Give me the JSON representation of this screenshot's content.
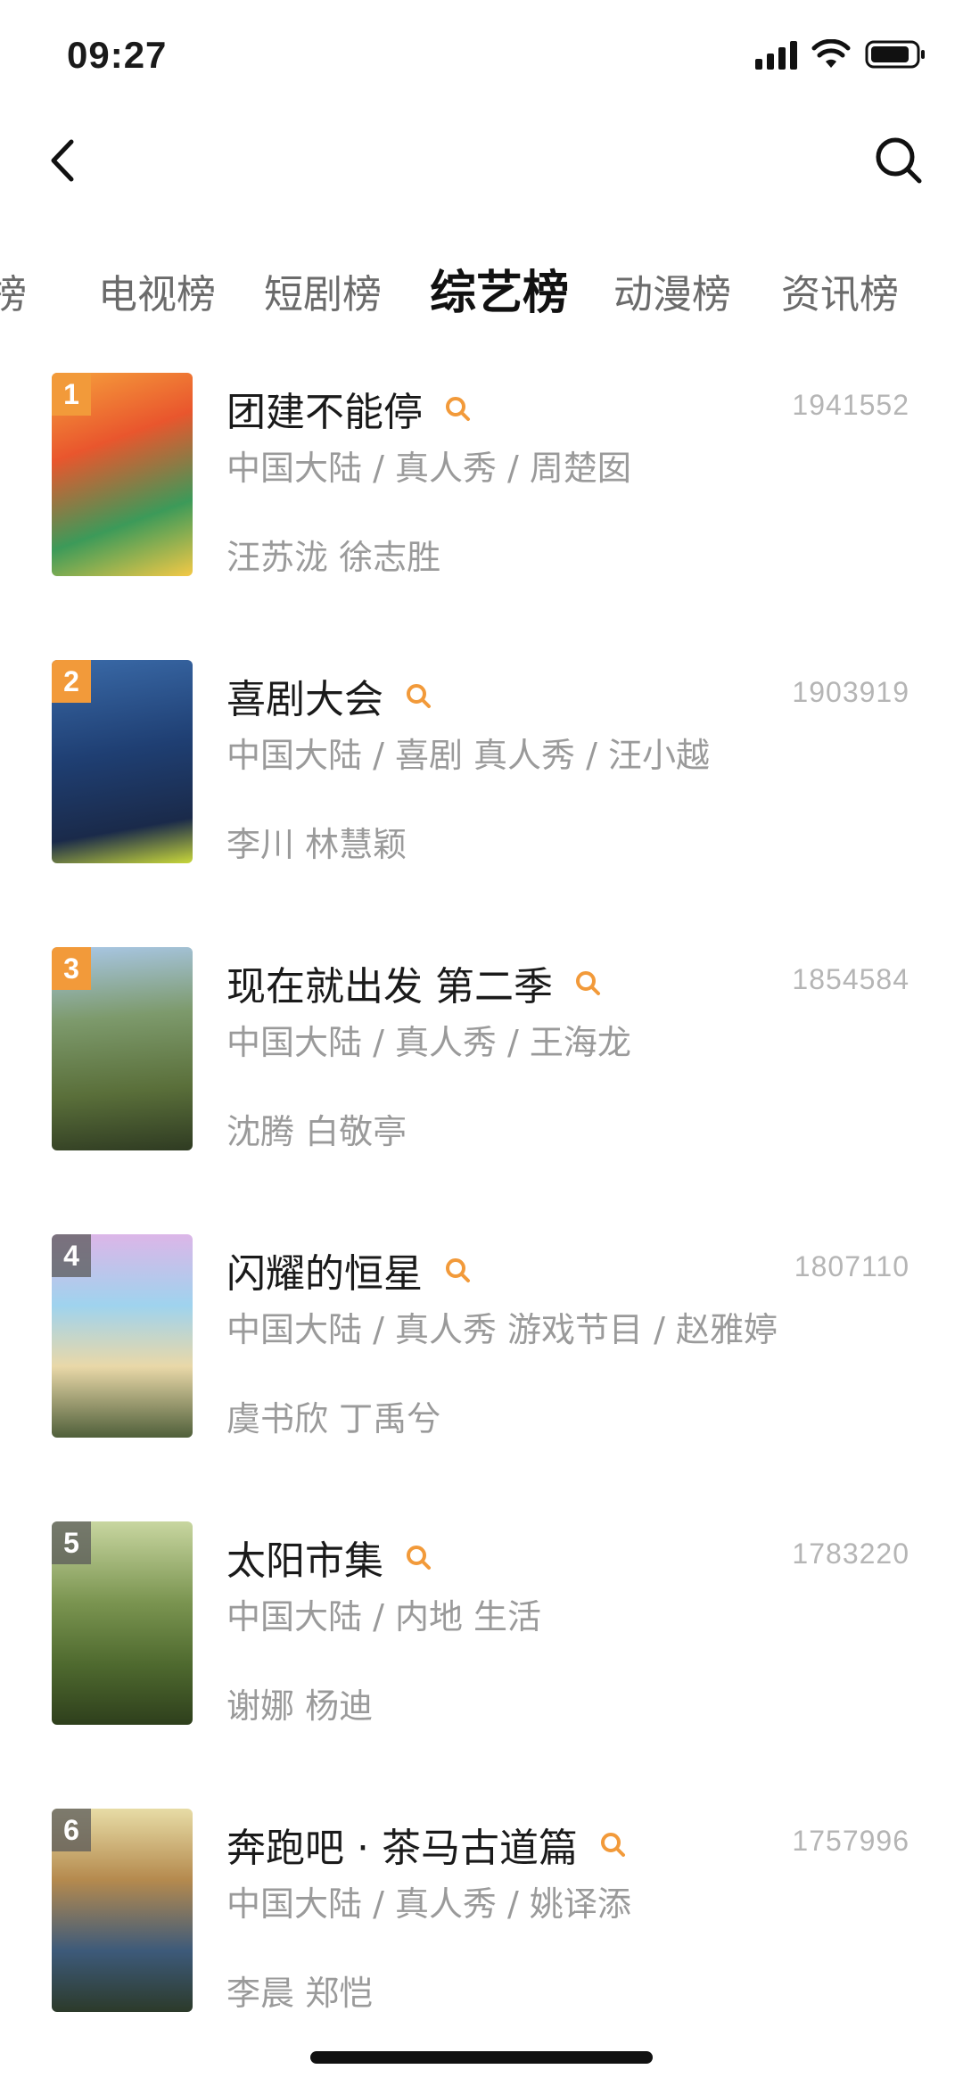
{
  "status_bar": {
    "time": "09:27"
  },
  "tabs": [
    {
      "label": "榜"
    },
    {
      "label": "电视榜"
    },
    {
      "label": "短剧榜"
    },
    {
      "label": "综艺榜",
      "active": true
    },
    {
      "label": "动漫榜"
    },
    {
      "label": "资讯榜"
    }
  ],
  "items": [
    {
      "rank": "1",
      "title": "团建不能停",
      "score": "1941552",
      "meta": "中国大陆 / 真人秀 / 周楚囡",
      "cast": "汪苏泷 徐志胜",
      "badge_color": "#f29a3a"
    },
    {
      "rank": "2",
      "title": "喜剧大会",
      "score": "1903919",
      "meta": "中国大陆 / 喜剧 真人秀 / 汪小越",
      "cast": "李川 林慧颖",
      "badge_color": "#f29a3a"
    },
    {
      "rank": "3",
      "title": "现在就出发 第二季",
      "score": "1854584",
      "meta": "中国大陆 / 真人秀 / 王海龙",
      "cast": "沈腾 白敬亭",
      "badge_color": "#f29a3a"
    },
    {
      "rank": "4",
      "title": "闪耀的恒星",
      "score": "1807110",
      "meta": "中国大陆 / 真人秀 游戏节目 / 赵雅婷",
      "cast": "虞书欣 丁禹兮",
      "badge_color": "#5a5a5a"
    },
    {
      "rank": "5",
      "title": "太阳市集",
      "score": "1783220",
      "meta": "中国大陆 / 内地 生活",
      "cast": "谢娜 杨迪",
      "badge_color": "#5a5a5a"
    },
    {
      "rank": "6",
      "title": "奔跑吧 · 茶马古道篇",
      "score": "1757996",
      "meta": "中国大陆 / 真人秀 / 姚译添",
      "cast": "李晨 郑恺",
      "badge_color": "#5a5a5a"
    }
  ],
  "colors": {
    "accent": "#f29a3a",
    "text_primary": "#1a1a1a",
    "text_secondary": "#9a9a9a",
    "score": "#b5b5b5"
  }
}
